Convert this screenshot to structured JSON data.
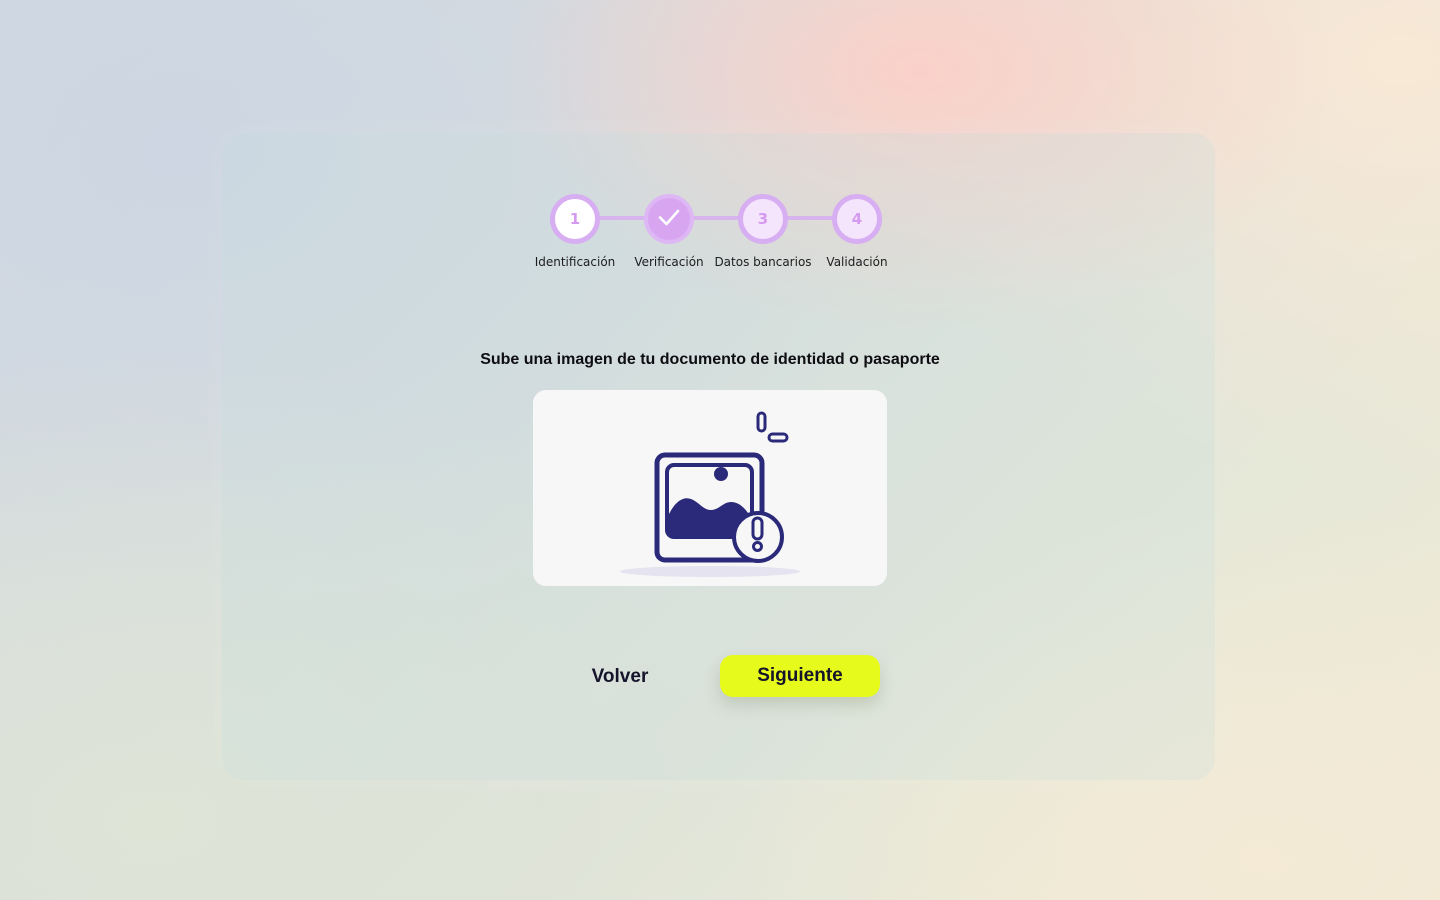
{
  "stepper": {
    "steps": [
      {
        "number": "1",
        "label": "Identificación",
        "state": "active"
      },
      {
        "number": "2",
        "label": "Verificación",
        "state": "completed",
        "icon": "check-icon"
      },
      {
        "number": "3",
        "label": "Datos bancarios",
        "state": "pending"
      },
      {
        "number": "4",
        "label": "Validación",
        "state": "pending"
      }
    ]
  },
  "main": {
    "title": "Sube una imagen de tu documento de identidad o pasaporte",
    "upload": {
      "icon": "image-warning-icon"
    }
  },
  "actions": {
    "back_label": "Volver",
    "next_label": "Siguiente"
  },
  "colors": {
    "accent": "#d8aef2",
    "primary_button": "#e6fb1c",
    "icon": "#2b2a7a"
  }
}
